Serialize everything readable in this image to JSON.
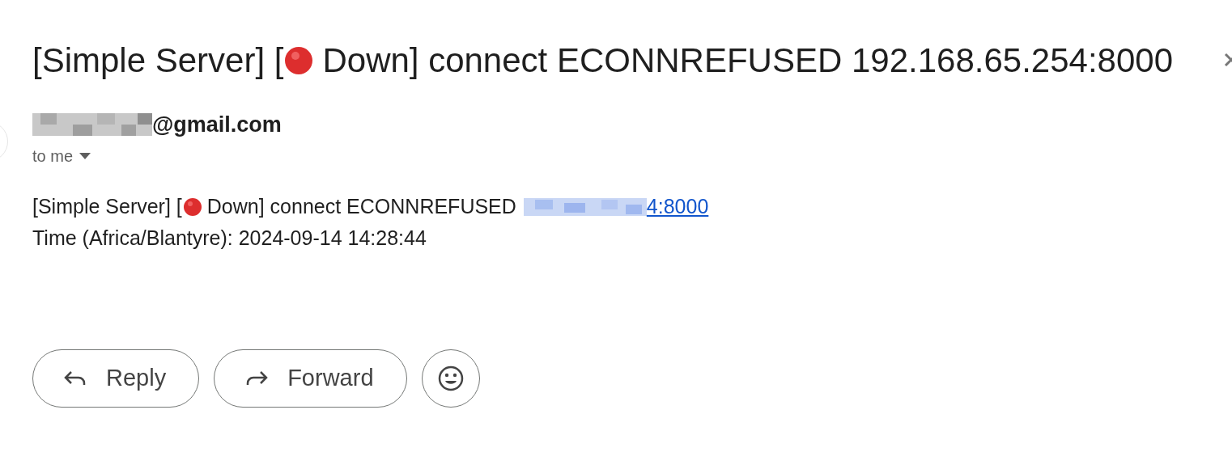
{
  "subject": {
    "before": "[Simple Server] [",
    "after": "Down] connect ECONNREFUSED 192.168.65.254:8000"
  },
  "sender": {
    "domain": "@gmail.com"
  },
  "recipient": {
    "label": "to me"
  },
  "body": {
    "line_1_before": "[Simple Server] [",
    "line_1_after": "Down] connect ECONNREFUSED",
    "link_tail": "4:8000",
    "line_2": "Time (Africa/Blantyre): 2024-09-14 14:28:44"
  },
  "actions": [
    {
      "kind": "reply",
      "label": "Reply"
    },
    {
      "kind": "forward",
      "label": "Forward"
    },
    {
      "kind": "emoji"
    }
  ]
}
